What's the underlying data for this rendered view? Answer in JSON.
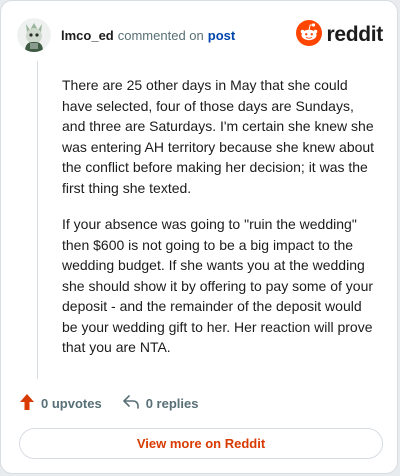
{
  "comment": {
    "username": "lmco_ed",
    "action_text": "commented on",
    "post_link": "post",
    "paragraphs": [
      "There are 25 other days in May that she could have selected, four of those days are Sundays, and three are Saturdays. I'm certain she knew she was entering AH territory because she knew about the conflict before making her decision; it was the first thing she texted.",
      "If your absence was going to \"ruin the wedding\" then $600 is not going to be a big impact to the wedding budget. If she wants you at the wedding she should show it by offering to pay some of your deposit - and the remainder of the deposit would be your wedding gift to her. Her reaction will prove that you are NTA."
    ]
  },
  "brand": {
    "wordmark": "reddit",
    "icon": "reddit-snoo-icon",
    "color": "#ff4500"
  },
  "actions": {
    "upvotes_label": "0 upvotes",
    "replies_label": "0 replies",
    "upvote_icon": "upvote-arrow-icon",
    "reply_icon": "reply-arrow-icon",
    "upvote_color": "#d93a00"
  },
  "footer": {
    "view_more_label": "View more on Reddit"
  },
  "colors": {
    "link": "#0045ac",
    "muted": "#576f76",
    "accent": "#d93a00"
  }
}
